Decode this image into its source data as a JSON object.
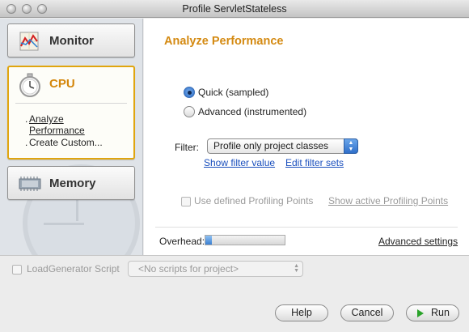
{
  "window": {
    "title": "Profile ServletStateless"
  },
  "sidebar": {
    "monitor": {
      "label": "Monitor",
      "icon": "monitor-chart-icon"
    },
    "cpu": {
      "label": "CPU",
      "icon": "stopwatch-icon",
      "items": [
        {
          "dot": ".",
          "label": "Analyze\nPerformance"
        },
        {
          "dot": ".",
          "label": "Create Custom..."
        }
      ]
    },
    "memory": {
      "label": "Memory",
      "icon": "memory-chip-icon"
    }
  },
  "main": {
    "title": "Analyze Performance",
    "modes": [
      {
        "label": "Quick (sampled)",
        "selected": true
      },
      {
        "label": "Advanced (instrumented)",
        "selected": false
      }
    ],
    "filter": {
      "label": "Filter:",
      "value": "Profile only project classes",
      "links": [
        "Show filter value",
        "Edit filter sets"
      ]
    },
    "profiling_points": {
      "checkbox_label": "Use defined Profiling Points",
      "checked": false,
      "enabled": false,
      "link": "Show active Profiling Points"
    },
    "overhead": {
      "label": "Overhead:",
      "level": 0.08
    },
    "advanced_link": "Advanced settings"
  },
  "load_generator": {
    "checkbox_label": "LoadGenerator Script",
    "checked": false,
    "select_value": "<No scripts for project>"
  },
  "buttons": {
    "help": "Help",
    "cancel": "Cancel",
    "run": "Run"
  },
  "colors": {
    "accent": "#d48a12",
    "link": "#1a4fbd",
    "selection": "#e0a50f"
  }
}
